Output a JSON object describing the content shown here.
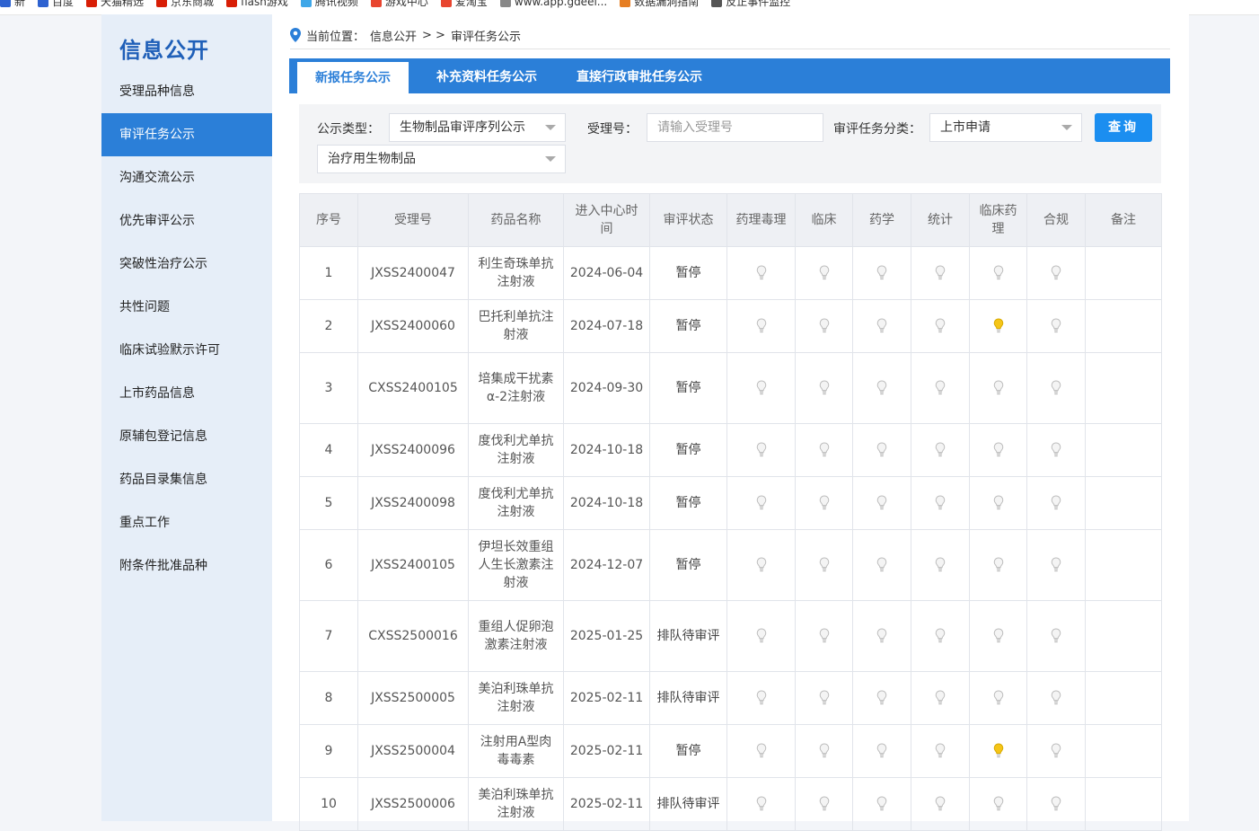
{
  "bookmarks": [
    "新",
    "百度",
    "天猫精选",
    "京东商城",
    "flash游戏",
    "腾讯视频",
    "游戏中心",
    "爱淘宝",
    "www.app.gdeei...",
    "数据漏洞指南",
    "反正事件监控"
  ],
  "sidebar": {
    "title": "信息公开",
    "items": [
      {
        "label": "受理品种信息"
      },
      {
        "label": "审评任务公示"
      },
      {
        "label": "沟通交流公示"
      },
      {
        "label": "优先审评公示"
      },
      {
        "label": "突破性治疗公示"
      },
      {
        "label": "共性问题"
      },
      {
        "label": "临床试验默示许可"
      },
      {
        "label": "上市药品信息"
      },
      {
        "label": "原辅包登记信息"
      },
      {
        "label": "药品目录集信息"
      },
      {
        "label": "重点工作"
      },
      {
        "label": "附条件批准品种"
      }
    ],
    "active_index": 1
  },
  "breadcrumb": {
    "prefix": "当前位置：",
    "section": "信息公开",
    "sep": "> >",
    "page": "审评任务公示"
  },
  "tabs": [
    {
      "label": "新报任务公示",
      "active": true
    },
    {
      "label": "补充资料任务公示",
      "active": false
    },
    {
      "label": "直接行政审批任务公示",
      "active": false
    }
  ],
  "filters": {
    "type_label": "公示类型：",
    "type_value": "生物制品审评序列公示",
    "subtype_value": "治疗用生物制品",
    "accept_label": "受理号：",
    "accept_placeholder": "请输入受理号",
    "category_label": "审评任务分类：",
    "category_value": "上市申请",
    "query_button": "查询"
  },
  "table": {
    "headers": [
      "序号",
      "受理号",
      "药品名称",
      "进入中心时间",
      "审评状态",
      "药理毒理",
      "临床",
      "药学",
      "统计",
      "临床药理",
      "合规",
      "备注"
    ],
    "rows": [
      {
        "no": "1",
        "id": "JXSS2400047",
        "name": "利生奇珠单抗注射液",
        "date": "2024-06-04",
        "status": "暂停",
        "lit": []
      },
      {
        "no": "2",
        "id": "JXSS2400060",
        "name": "巴托利单抗注射液",
        "date": "2024-07-18",
        "status": "暂停",
        "lit": [
          4
        ]
      },
      {
        "no": "3",
        "id": "CXSS2400105",
        "name": "培集成干扰素α-2注射液",
        "date": "2024-09-30",
        "status": "暂停",
        "lit": []
      },
      {
        "no": "4",
        "id": "JXSS2400096",
        "name": "度伐利尤单抗注射液",
        "date": "2024-10-18",
        "status": "暂停",
        "lit": []
      },
      {
        "no": "5",
        "id": "JXSS2400098",
        "name": "度伐利尤单抗注射液",
        "date": "2024-10-18",
        "status": "暂停",
        "lit": []
      },
      {
        "no": "6",
        "id": "JXSS2400105",
        "name": "伊坦长效重组人生长激素注射液",
        "date": "2024-12-07",
        "status": "暂停",
        "lit": []
      },
      {
        "no": "7",
        "id": "CXSS2500016",
        "name": "重组人促卵泡激素注射液",
        "date": "2025-01-25",
        "status": "排队待审评",
        "lit": []
      },
      {
        "no": "8",
        "id": "JXSS2500005",
        "name": "美泊利珠单抗注射液",
        "date": "2025-02-11",
        "status": "排队待审评",
        "lit": []
      },
      {
        "no": "9",
        "id": "JXSS2500004",
        "name": "注射用A型肉毒毒素",
        "date": "2025-02-11",
        "status": "暂停",
        "lit": [
          4
        ]
      },
      {
        "no": "10",
        "id": "JXSS2500006",
        "name": "美泊利珠单抗注射液",
        "date": "2025-02-11",
        "status": "排队待审评",
        "lit": []
      }
    ]
  },
  "colors": {
    "accent": "#2b7fd8",
    "bulb_on": "#f5c518",
    "bulb_off": "#d9d9d9"
  }
}
